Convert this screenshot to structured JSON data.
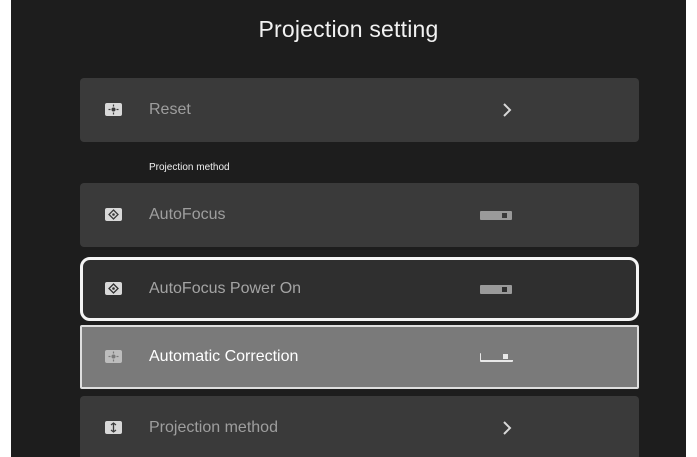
{
  "header": {
    "title": "Projection setting"
  },
  "rows": [
    {
      "label": "Reset",
      "icon": "target-icon",
      "control": "chevron"
    },
    {
      "label": "AutoFocus",
      "icon": "focus-icon",
      "control": "toggle",
      "toggle_on": false
    },
    {
      "label": "AutoFocus Power On",
      "icon": "focus-icon",
      "control": "toggle",
      "toggle_on": false
    },
    {
      "label": "Automatic Correction",
      "icon": "target-icon",
      "control": "toggle",
      "toggle_on": false
    },
    {
      "label": "Projection method",
      "icon": "projection-icon",
      "control": "chevron"
    }
  ],
  "section": {
    "label": "Projection method"
  },
  "colors": {
    "background": "#1d1d1d",
    "row": "#3a3a3a",
    "row_selected": "#7a7a7a",
    "focus_border": "#f4f4f4"
  }
}
